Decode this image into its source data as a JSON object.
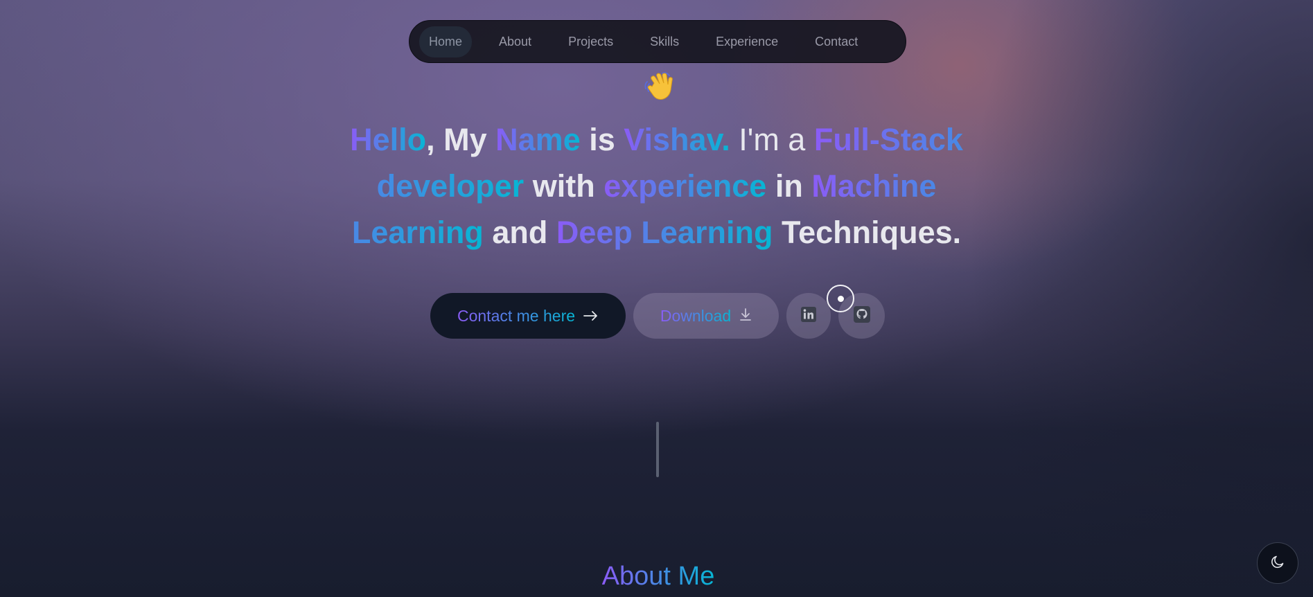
{
  "nav": {
    "items": [
      {
        "label": "Home",
        "active": true
      },
      {
        "label": "About",
        "active": false
      },
      {
        "label": "Projects",
        "active": false
      },
      {
        "label": "Skills",
        "active": false
      },
      {
        "label": "Experience",
        "active": false
      },
      {
        "label": "Contact",
        "active": false
      }
    ]
  },
  "hero": {
    "wave_icon": "waving-hand-icon",
    "headline": {
      "w1": "Hello",
      "w2": ", My ",
      "w3": "Name",
      "w4": " is ",
      "w5": "Vishav.",
      "w6": " I'm a ",
      "w7": "Full-Stack developer",
      "w8": " with ",
      "w9": "experience",
      "w10": " in ",
      "w11": "Machine Learning",
      "w12": " and ",
      "w13": "Deep Learning",
      "w14": " Techniques."
    },
    "contact_button": {
      "label": "Contact me here",
      "icon": "arrow-right-icon"
    },
    "download_button": {
      "label": "Download",
      "icon": "download-icon"
    },
    "social": [
      {
        "icon": "linkedin-icon"
      },
      {
        "icon": "github-icon"
      }
    ]
  },
  "about": {
    "title": "About Me"
  },
  "theme_toggle": {
    "icon": "moon-icon"
  },
  "colors": {
    "gradient_start": "#8b5cf6",
    "gradient_end": "#06b6d4",
    "headline_text": "#e8e8ee",
    "button_dark": "#111827"
  }
}
